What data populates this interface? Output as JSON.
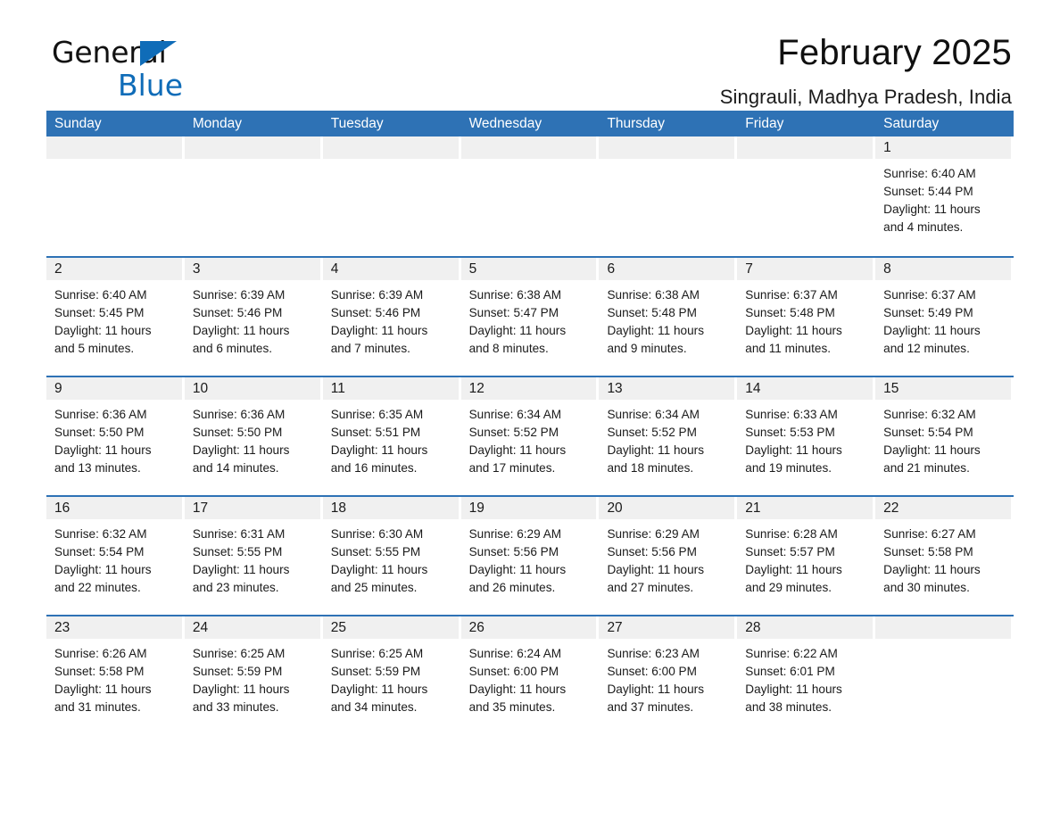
{
  "brand": {
    "name_part1": "General",
    "name_part2": "Blue"
  },
  "header": {
    "title": "February 2025",
    "subtitle": "Singrauli, Madhya Pradesh, India"
  },
  "calendar": {
    "weekday_headers": [
      "Sunday",
      "Monday",
      "Tuesday",
      "Wednesday",
      "Thursday",
      "Friday",
      "Saturday"
    ],
    "colors": {
      "header_blue": "#2e72b5",
      "day_band_gray": "#f0f0f0",
      "text": "#1a1a1a",
      "brand_blue": "#0f6cb8"
    },
    "weeks": [
      [
        {
          "day": "",
          "sunrise": "",
          "sunset": "",
          "daylight_line1": "",
          "daylight_line2": ""
        },
        {
          "day": "",
          "sunrise": "",
          "sunset": "",
          "daylight_line1": "",
          "daylight_line2": ""
        },
        {
          "day": "",
          "sunrise": "",
          "sunset": "",
          "daylight_line1": "",
          "daylight_line2": ""
        },
        {
          "day": "",
          "sunrise": "",
          "sunset": "",
          "daylight_line1": "",
          "daylight_line2": ""
        },
        {
          "day": "",
          "sunrise": "",
          "sunset": "",
          "daylight_line1": "",
          "daylight_line2": ""
        },
        {
          "day": "",
          "sunrise": "",
          "sunset": "",
          "daylight_line1": "",
          "daylight_line2": ""
        },
        {
          "day": "1",
          "sunrise": "Sunrise: 6:40 AM",
          "sunset": "Sunset: 5:44 PM",
          "daylight_line1": "Daylight: 11 hours",
          "daylight_line2": "and 4 minutes."
        }
      ],
      [
        {
          "day": "2",
          "sunrise": "Sunrise: 6:40 AM",
          "sunset": "Sunset: 5:45 PM",
          "daylight_line1": "Daylight: 11 hours",
          "daylight_line2": "and 5 minutes."
        },
        {
          "day": "3",
          "sunrise": "Sunrise: 6:39 AM",
          "sunset": "Sunset: 5:46 PM",
          "daylight_line1": "Daylight: 11 hours",
          "daylight_line2": "and 6 minutes."
        },
        {
          "day": "4",
          "sunrise": "Sunrise: 6:39 AM",
          "sunset": "Sunset: 5:46 PM",
          "daylight_line1": "Daylight: 11 hours",
          "daylight_line2": "and 7 minutes."
        },
        {
          "day": "5",
          "sunrise": "Sunrise: 6:38 AM",
          "sunset": "Sunset: 5:47 PM",
          "daylight_line1": "Daylight: 11 hours",
          "daylight_line2": "and 8 minutes."
        },
        {
          "day": "6",
          "sunrise": "Sunrise: 6:38 AM",
          "sunset": "Sunset: 5:48 PM",
          "daylight_line1": "Daylight: 11 hours",
          "daylight_line2": "and 9 minutes."
        },
        {
          "day": "7",
          "sunrise": "Sunrise: 6:37 AM",
          "sunset": "Sunset: 5:48 PM",
          "daylight_line1": "Daylight: 11 hours",
          "daylight_line2": "and 11 minutes."
        },
        {
          "day": "8",
          "sunrise": "Sunrise: 6:37 AM",
          "sunset": "Sunset: 5:49 PM",
          "daylight_line1": "Daylight: 11 hours",
          "daylight_line2": "and 12 minutes."
        }
      ],
      [
        {
          "day": "9",
          "sunrise": "Sunrise: 6:36 AM",
          "sunset": "Sunset: 5:50 PM",
          "daylight_line1": "Daylight: 11 hours",
          "daylight_line2": "and 13 minutes."
        },
        {
          "day": "10",
          "sunrise": "Sunrise: 6:36 AM",
          "sunset": "Sunset: 5:50 PM",
          "daylight_line1": "Daylight: 11 hours",
          "daylight_line2": "and 14 minutes."
        },
        {
          "day": "11",
          "sunrise": "Sunrise: 6:35 AM",
          "sunset": "Sunset: 5:51 PM",
          "daylight_line1": "Daylight: 11 hours",
          "daylight_line2": "and 16 minutes."
        },
        {
          "day": "12",
          "sunrise": "Sunrise: 6:34 AM",
          "sunset": "Sunset: 5:52 PM",
          "daylight_line1": "Daylight: 11 hours",
          "daylight_line2": "and 17 minutes."
        },
        {
          "day": "13",
          "sunrise": "Sunrise: 6:34 AM",
          "sunset": "Sunset: 5:52 PM",
          "daylight_line1": "Daylight: 11 hours",
          "daylight_line2": "and 18 minutes."
        },
        {
          "day": "14",
          "sunrise": "Sunrise: 6:33 AM",
          "sunset": "Sunset: 5:53 PM",
          "daylight_line1": "Daylight: 11 hours",
          "daylight_line2": "and 19 minutes."
        },
        {
          "day": "15",
          "sunrise": "Sunrise: 6:32 AM",
          "sunset": "Sunset: 5:54 PM",
          "daylight_line1": "Daylight: 11 hours",
          "daylight_line2": "and 21 minutes."
        }
      ],
      [
        {
          "day": "16",
          "sunrise": "Sunrise: 6:32 AM",
          "sunset": "Sunset: 5:54 PM",
          "daylight_line1": "Daylight: 11 hours",
          "daylight_line2": "and 22 minutes."
        },
        {
          "day": "17",
          "sunrise": "Sunrise: 6:31 AM",
          "sunset": "Sunset: 5:55 PM",
          "daylight_line1": "Daylight: 11 hours",
          "daylight_line2": "and 23 minutes."
        },
        {
          "day": "18",
          "sunrise": "Sunrise: 6:30 AM",
          "sunset": "Sunset: 5:55 PM",
          "daylight_line1": "Daylight: 11 hours",
          "daylight_line2": "and 25 minutes."
        },
        {
          "day": "19",
          "sunrise": "Sunrise: 6:29 AM",
          "sunset": "Sunset: 5:56 PM",
          "daylight_line1": "Daylight: 11 hours",
          "daylight_line2": "and 26 minutes."
        },
        {
          "day": "20",
          "sunrise": "Sunrise: 6:29 AM",
          "sunset": "Sunset: 5:56 PM",
          "daylight_line1": "Daylight: 11 hours",
          "daylight_line2": "and 27 minutes."
        },
        {
          "day": "21",
          "sunrise": "Sunrise: 6:28 AM",
          "sunset": "Sunset: 5:57 PM",
          "daylight_line1": "Daylight: 11 hours",
          "daylight_line2": "and 29 minutes."
        },
        {
          "day": "22",
          "sunrise": "Sunrise: 6:27 AM",
          "sunset": "Sunset: 5:58 PM",
          "daylight_line1": "Daylight: 11 hours",
          "daylight_line2": "and 30 minutes."
        }
      ],
      [
        {
          "day": "23",
          "sunrise": "Sunrise: 6:26 AM",
          "sunset": "Sunset: 5:58 PM",
          "daylight_line1": "Daylight: 11 hours",
          "daylight_line2": "and 31 minutes."
        },
        {
          "day": "24",
          "sunrise": "Sunrise: 6:25 AM",
          "sunset": "Sunset: 5:59 PM",
          "daylight_line1": "Daylight: 11 hours",
          "daylight_line2": "and 33 minutes."
        },
        {
          "day": "25",
          "sunrise": "Sunrise: 6:25 AM",
          "sunset": "Sunset: 5:59 PM",
          "daylight_line1": "Daylight: 11 hours",
          "daylight_line2": "and 34 minutes."
        },
        {
          "day": "26",
          "sunrise": "Sunrise: 6:24 AM",
          "sunset": "Sunset: 6:00 PM",
          "daylight_line1": "Daylight: 11 hours",
          "daylight_line2": "and 35 minutes."
        },
        {
          "day": "27",
          "sunrise": "Sunrise: 6:23 AM",
          "sunset": "Sunset: 6:00 PM",
          "daylight_line1": "Daylight: 11 hours",
          "daylight_line2": "and 37 minutes."
        },
        {
          "day": "28",
          "sunrise": "Sunrise: 6:22 AM",
          "sunset": "Sunset: 6:01 PM",
          "daylight_line1": "Daylight: 11 hours",
          "daylight_line2": "and 38 minutes."
        },
        {
          "day": "",
          "sunrise": "",
          "sunset": "",
          "daylight_line1": "",
          "daylight_line2": ""
        }
      ]
    ]
  }
}
